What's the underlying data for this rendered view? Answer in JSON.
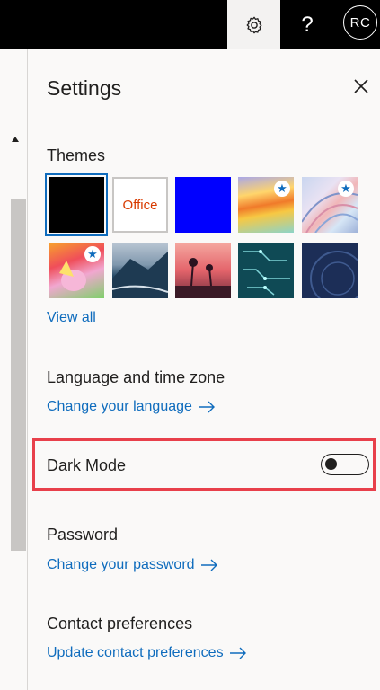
{
  "topbar": {
    "help_label": "?",
    "avatar_initials": "RC"
  },
  "settings": {
    "title": "Settings",
    "themes": {
      "heading": "Themes",
      "office_label": "Office",
      "view_all": "View all",
      "tiles": [
        {
          "name": "black",
          "selected": true
        },
        {
          "name": "office"
        },
        {
          "name": "blue"
        },
        {
          "name": "rainbow",
          "premium": true
        },
        {
          "name": "abstract-lines",
          "premium": true
        },
        {
          "name": "unicorn",
          "premium": true
        },
        {
          "name": "mountain"
        },
        {
          "name": "palms"
        },
        {
          "name": "circuit"
        },
        {
          "name": "innovation"
        }
      ]
    },
    "language": {
      "heading": "Language and time zone",
      "link": "Change your language"
    },
    "dark_mode": {
      "label": "Dark Mode",
      "enabled": false
    },
    "password": {
      "heading": "Password",
      "link": "Change your password"
    },
    "contact": {
      "heading": "Contact preferences",
      "link": "Update contact preferences"
    }
  },
  "colors": {
    "accent": "#0f6cbd",
    "highlight": "#e8404b",
    "topbar": "#000000"
  }
}
